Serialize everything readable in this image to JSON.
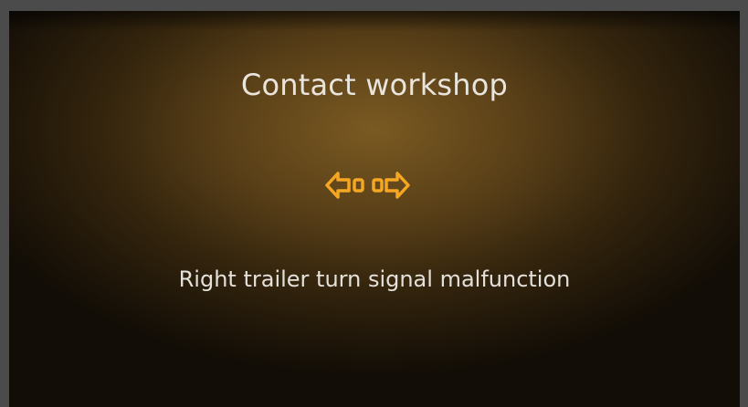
{
  "display": {
    "title": "Contact workshop",
    "message": "Right trailer turn signal malfunction",
    "icon": "trailer-turn-signal-icon",
    "icon_color": "#f5a623",
    "text_color": "#e9e4dc"
  }
}
